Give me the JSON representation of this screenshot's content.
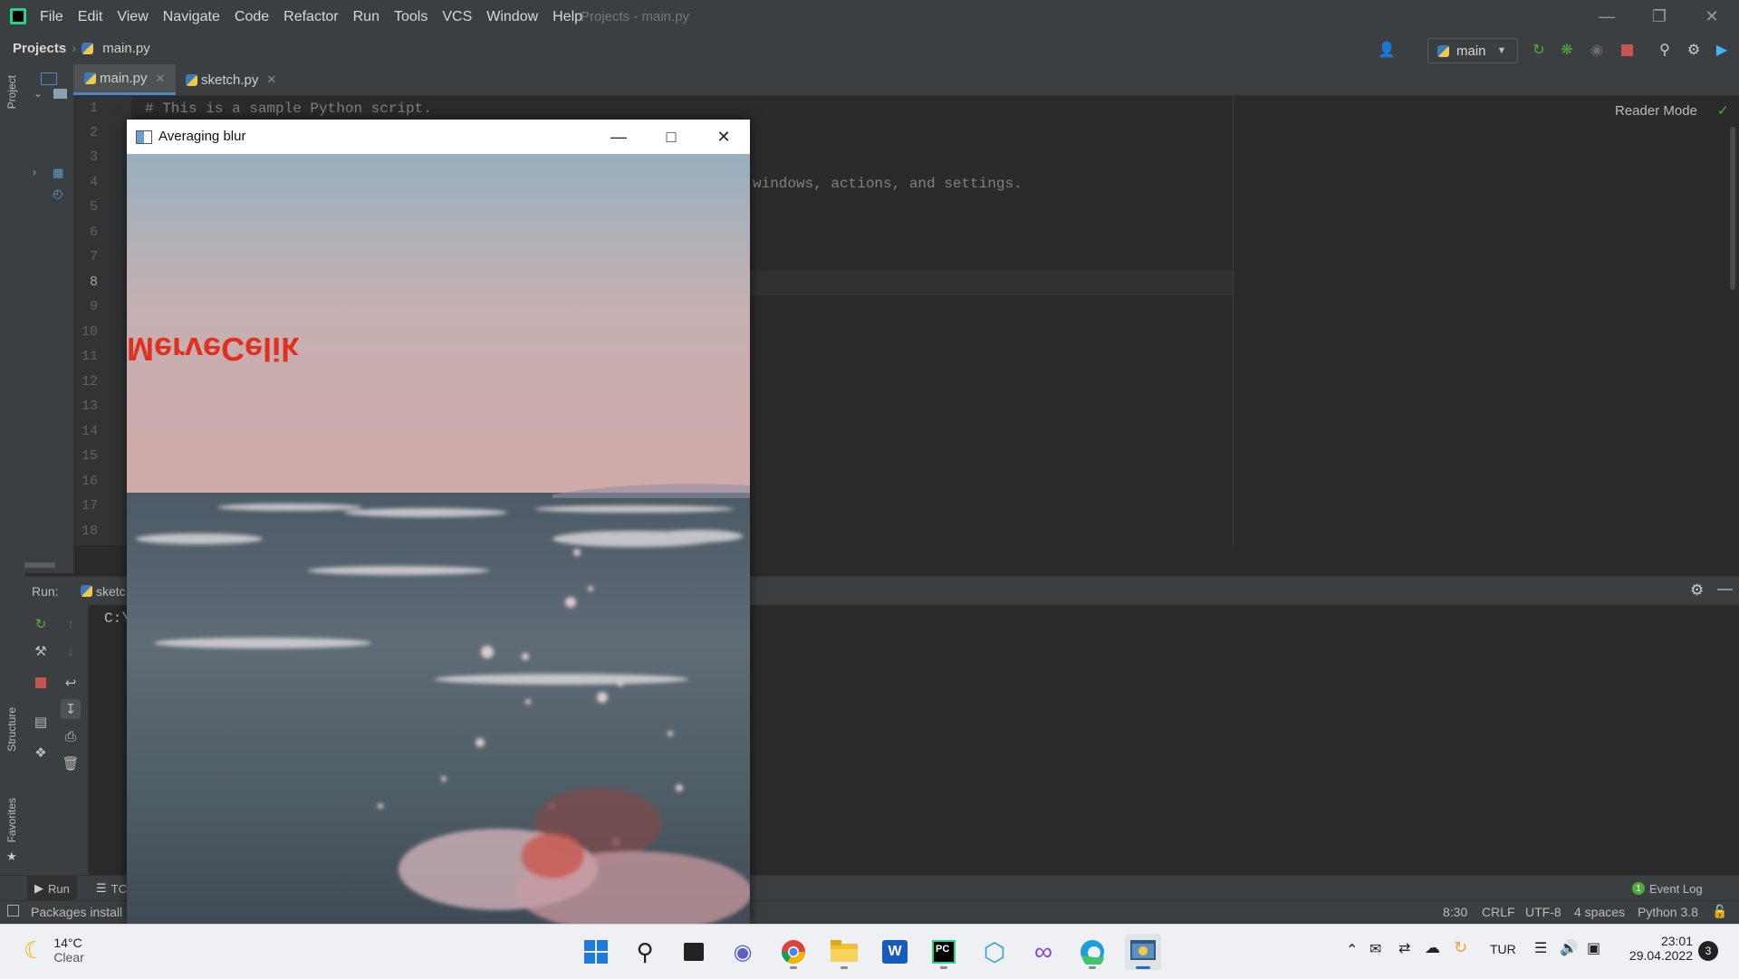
{
  "menu": [
    "File",
    "Edit",
    "View",
    "Navigate",
    "Code",
    "Refactor",
    "Run",
    "Tools",
    "VCS",
    "Window",
    "Help"
  ],
  "window_title": "Projects - main.py",
  "breadcrumb": {
    "root": "Projects",
    "file": "main.py"
  },
  "run_config": "main",
  "sidebar": {
    "project": "Project",
    "structure": "Structure",
    "favorites": "Favorites"
  },
  "tabs": [
    {
      "label": "main.py",
      "active": true
    },
    {
      "label": "sketch.py",
      "active": false
    }
  ],
  "editor": {
    "line_numbers": [
      "1",
      "2",
      "3",
      "4",
      "5",
      "6",
      "7",
      "8",
      "9",
      "10",
      "11",
      "12",
      "13",
      "14",
      "15",
      "16",
      "17",
      "18"
    ],
    "current_line": "8",
    "line1": "# This is a sample Python script.",
    "line4_visible": "windows, actions, and settings.",
    "reader_mode": "Reader Mode"
  },
  "run_panel": {
    "label": "Run:",
    "tab": "sketc",
    "console": "C:\\"
  },
  "bottom_tabs": {
    "run": "Run",
    "todo": "TC",
    "event_log": "Event Log",
    "event_count": "1"
  },
  "status": {
    "message": "Packages install",
    "position": "8:30",
    "line_sep": "CRLF",
    "encoding": "UTF-8",
    "indent": "4 spaces",
    "interpreter": "Python 3.8"
  },
  "cv_window": {
    "title": "Averaging blur",
    "overlay_text": "MerveCelik",
    "overlay_color": "#e03020"
  },
  "taskbar": {
    "weather_temp": "14°C",
    "weather_desc": "Clear",
    "lang": "TUR",
    "time": "23:01",
    "date": "29.04.2022",
    "notifications": "3"
  },
  "colors": {
    "accent": "#4a88c7",
    "run_green": "#4fad3e",
    "stop_red": "#c75450"
  }
}
